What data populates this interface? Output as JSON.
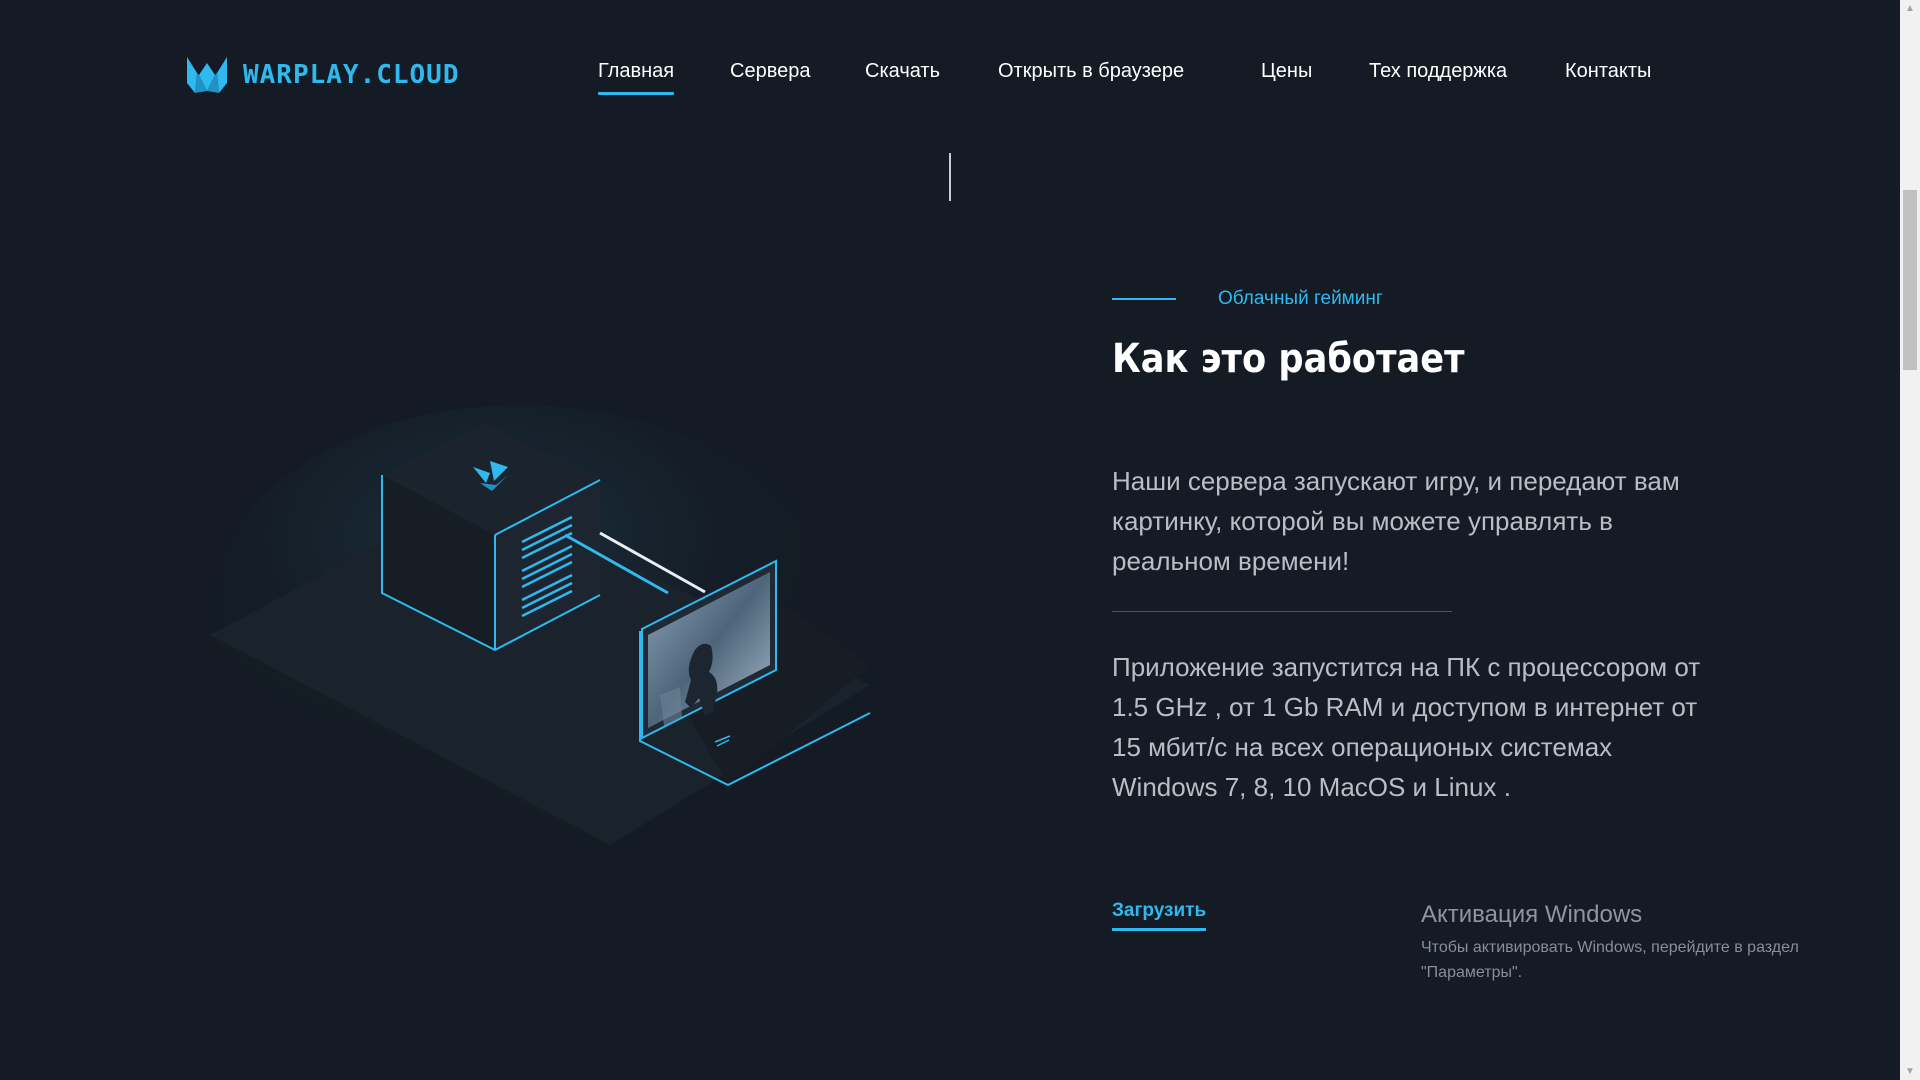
{
  "header": {
    "logo_text": "WARPLAY.CLOUD",
    "nav": [
      {
        "label": "Главная",
        "active": true
      },
      {
        "label": "Сервера",
        "active": false
      },
      {
        "label": "Скачать",
        "active": false
      },
      {
        "label": "Открыть в браузере",
        "active": false
      },
      {
        "label": "Цены",
        "active": false
      },
      {
        "label": "Тех поддержка",
        "active": false
      },
      {
        "label": "Контакты",
        "active": false
      }
    ]
  },
  "section": {
    "eyebrow": "Облачный гейминг",
    "title": "Как это работает",
    "paragraph_1": "Наши сервера запускают игру, и передают вам картинку, которой вы можете управлять в реальном времени!",
    "paragraph_2": "Приложение запустится на ПК с процессором от 1.5 GHz , от 1 Gb RAM и доступом в интернет от 15 мбит/с на всех операционых системах Windows 7, 8, 10 MacOS и Linux .",
    "download_label": "Загрузить"
  },
  "watermark": {
    "title": "Активация Windows",
    "text": "Чтобы активировать Windows, перейдите в раздел \"Параметры\"."
  },
  "colors": {
    "background": "#141b24",
    "accent": "#2fb9ee",
    "text_primary": "#ffffff",
    "text_muted": "#b9bec6"
  },
  "icons": {
    "logo": "warplay-logo-icon",
    "scroll_up": "arrow-up-icon",
    "scroll_down": "arrow-down-icon"
  }
}
